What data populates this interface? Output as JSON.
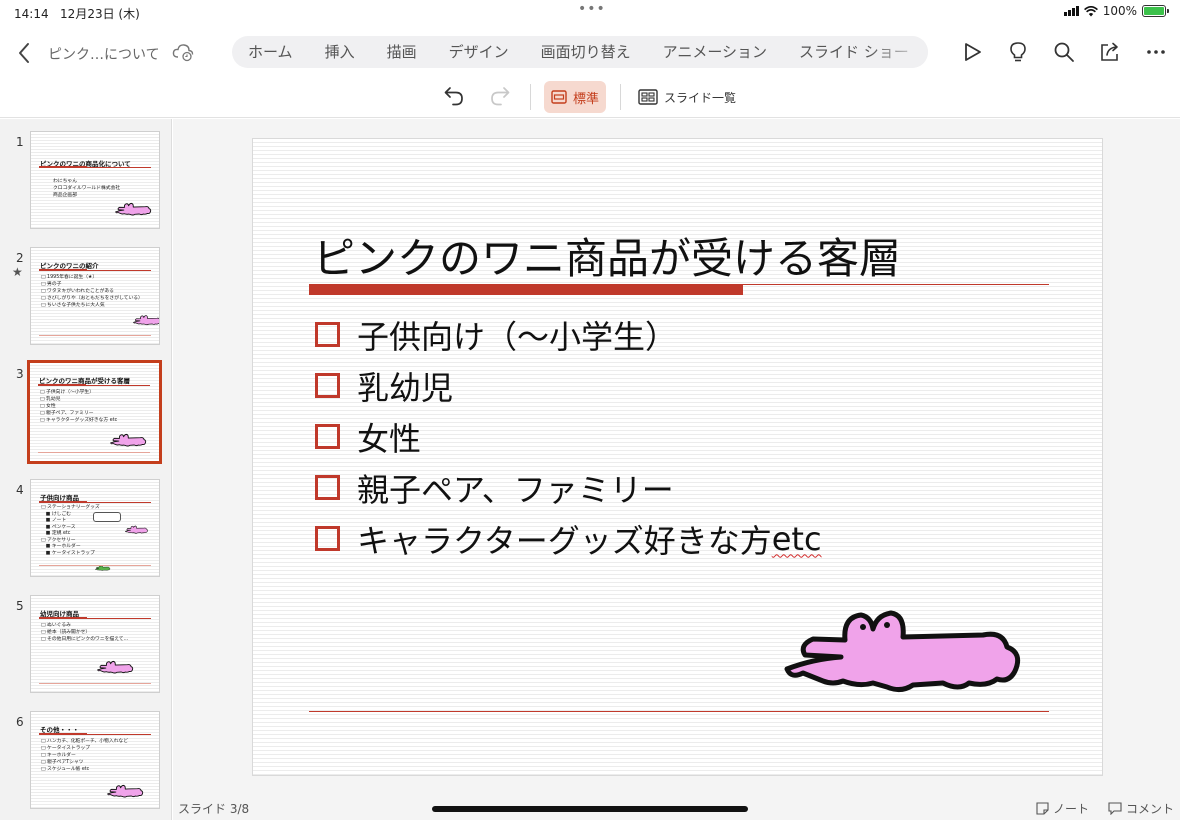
{
  "status": {
    "time": "14:14",
    "date": "12月23日 (木)",
    "battery": "100%",
    "battery_level": 1.0
  },
  "document": {
    "title": "ピンク…について"
  },
  "ribbon_tabs": [
    "ホーム",
    "挿入",
    "描画",
    "デザイン",
    "画面切り替え",
    "アニメーション",
    "スライド ショー"
  ],
  "toolbar": {
    "normal_label": "標準",
    "slide_list_label": "スライド一覧"
  },
  "thumbnails": [
    {
      "number": "1",
      "title": "ピンクのワニの商品化について",
      "lines": [
        "わにちゃん",
        "クロコダイルワールド株式会社",
        "商品企画部"
      ],
      "starred": false,
      "selected": false
    },
    {
      "number": "2",
      "title": "ピンクのワニの紹介",
      "lines": [
        "□ 1995年春に誕生（★）",
        "□ 男の子",
        "□ ワタヌキがいわれたことがある",
        "□ さびしがりや（おともだちをさがしている）",
        "□ ちいさな子供たちに大人気"
      ],
      "starred": true,
      "selected": false
    },
    {
      "number": "3",
      "title": "ピンクのワニ商品が受ける客層",
      "lines": [
        "□ 子供向け（〜小学生）",
        "□ 乳幼児",
        "□ 女性",
        "□ 親子ペア、ファミリー",
        "□ キャラクターグッズ好きな方 etc"
      ],
      "starred": false,
      "selected": true
    },
    {
      "number": "4",
      "title": "子供向け商品",
      "lines": [
        "□ ステーショナリーグッズ",
        "　■ けしごむ",
        "　■ ノート",
        "　■ ペンケース",
        "　■ 定規 etc",
        "□ アクセサリー",
        "　■ キーホルダー",
        "　■ ケータイストラップ"
      ],
      "starred": false,
      "selected": false
    },
    {
      "number": "5",
      "title": "幼児向け商品",
      "lines": [
        "□ ぬいぐるみ",
        "□ 絵本（読み聞かせ）",
        "□ その他日用にピンクのワニを描えて..."
      ],
      "starred": false,
      "selected": false
    },
    {
      "number": "6",
      "title": "その他・・・",
      "lines": [
        "□ ハンカチ、化粧ポーチ、小物入れなど",
        "□ ケータイストラップ",
        "□ キーホルダー",
        "□ 親子ペアTシャツ",
        "□ スケジュール帳 etc"
      ],
      "starred": false,
      "selected": false
    }
  ],
  "slide": {
    "title": "ピンクのワニ商品が受ける客層",
    "bullets": [
      "子供向け（～小学生）",
      "乳幼児",
      "女性",
      "親子ペア、ファミリー",
      "キャラクターグッズ好きな方 "
    ],
    "last_bullet_suffix": "etc"
  },
  "footer": {
    "slide_counter": "スライド 3/8",
    "notes_label": "ノート",
    "comments_label": "コメント"
  },
  "colors": {
    "accent": "#c43e1c",
    "rule": "#c0392b",
    "croc_pink": "#f0a3ea"
  },
  "icons": [
    "back-icon",
    "cloud-sync-icon",
    "play-icon",
    "lightbulb-icon",
    "search-icon",
    "share-icon",
    "more-icon",
    "undo-icon",
    "redo-icon",
    "normal-view-icon",
    "slide-list-icon",
    "notes-icon",
    "comment-icon"
  ]
}
